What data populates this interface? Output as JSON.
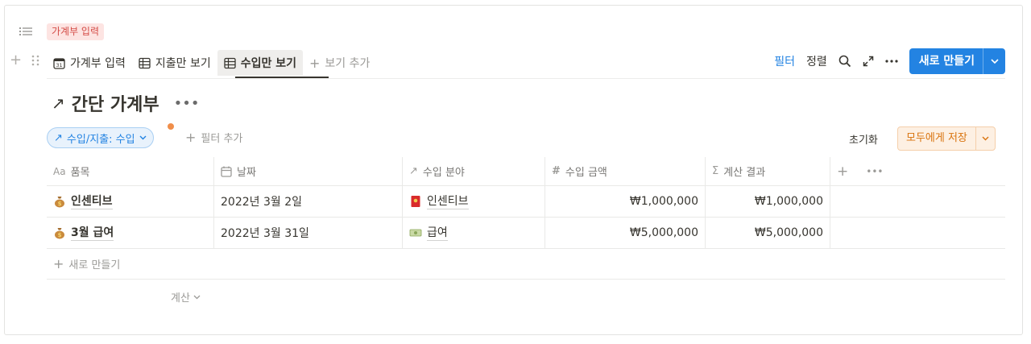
{
  "header": {
    "tag": "가계부 입력"
  },
  "tabs": [
    {
      "label": "가계부 입력",
      "icon": "calendar-icon"
    },
    {
      "label": "지출만 보기",
      "icon": "table-icon"
    },
    {
      "label": "수입만 보기",
      "icon": "table-icon",
      "active": true
    },
    {
      "label": "보기 추가",
      "icon": "plus-icon"
    }
  ],
  "toolbar": {
    "filter": "필터",
    "sort": "정렬",
    "new_button": "새로 만들기"
  },
  "database": {
    "title": "간단 가계부"
  },
  "filters": {
    "active_filter": "수입/지출: 수입",
    "add_filter": "필터 추가",
    "reset": "초기화",
    "save_for_all": "모두에게 저장"
  },
  "table": {
    "columns": [
      {
        "label": "품목",
        "icon": "text-property-icon"
      },
      {
        "label": "날짜",
        "icon": "calendar-icon"
      },
      {
        "label": "수입 분야",
        "icon": "relation-arrow-icon"
      },
      {
        "label": "수입 금액",
        "icon": "number-hash-icon"
      },
      {
        "label": "계산 결과",
        "icon": "sigma-formula-icon"
      }
    ],
    "rows": [
      {
        "name": "인센티브",
        "name_icon": "money-bag-icon",
        "date": "2022년 3월 2일",
        "category": "인센티브",
        "category_icon": "red-envelope-icon",
        "amount": "₩1,000,000",
        "result": "₩1,000,000"
      },
      {
        "name": "3월 급여",
        "name_icon": "money-bag-icon",
        "date": "2022년 3월 31일",
        "category": "급여",
        "category_icon": "banknote-icon",
        "amount": "₩5,000,000",
        "result": "₩5,000,000"
      }
    ],
    "new_row": "새로 만들기",
    "calculate": "계산"
  },
  "colors": {
    "accent": "#2383e2",
    "tag_bg": "#fde4e2",
    "tag_text": "#d44c47",
    "save_text": "#d9730d",
    "save_bg": "#fdf0e3"
  }
}
